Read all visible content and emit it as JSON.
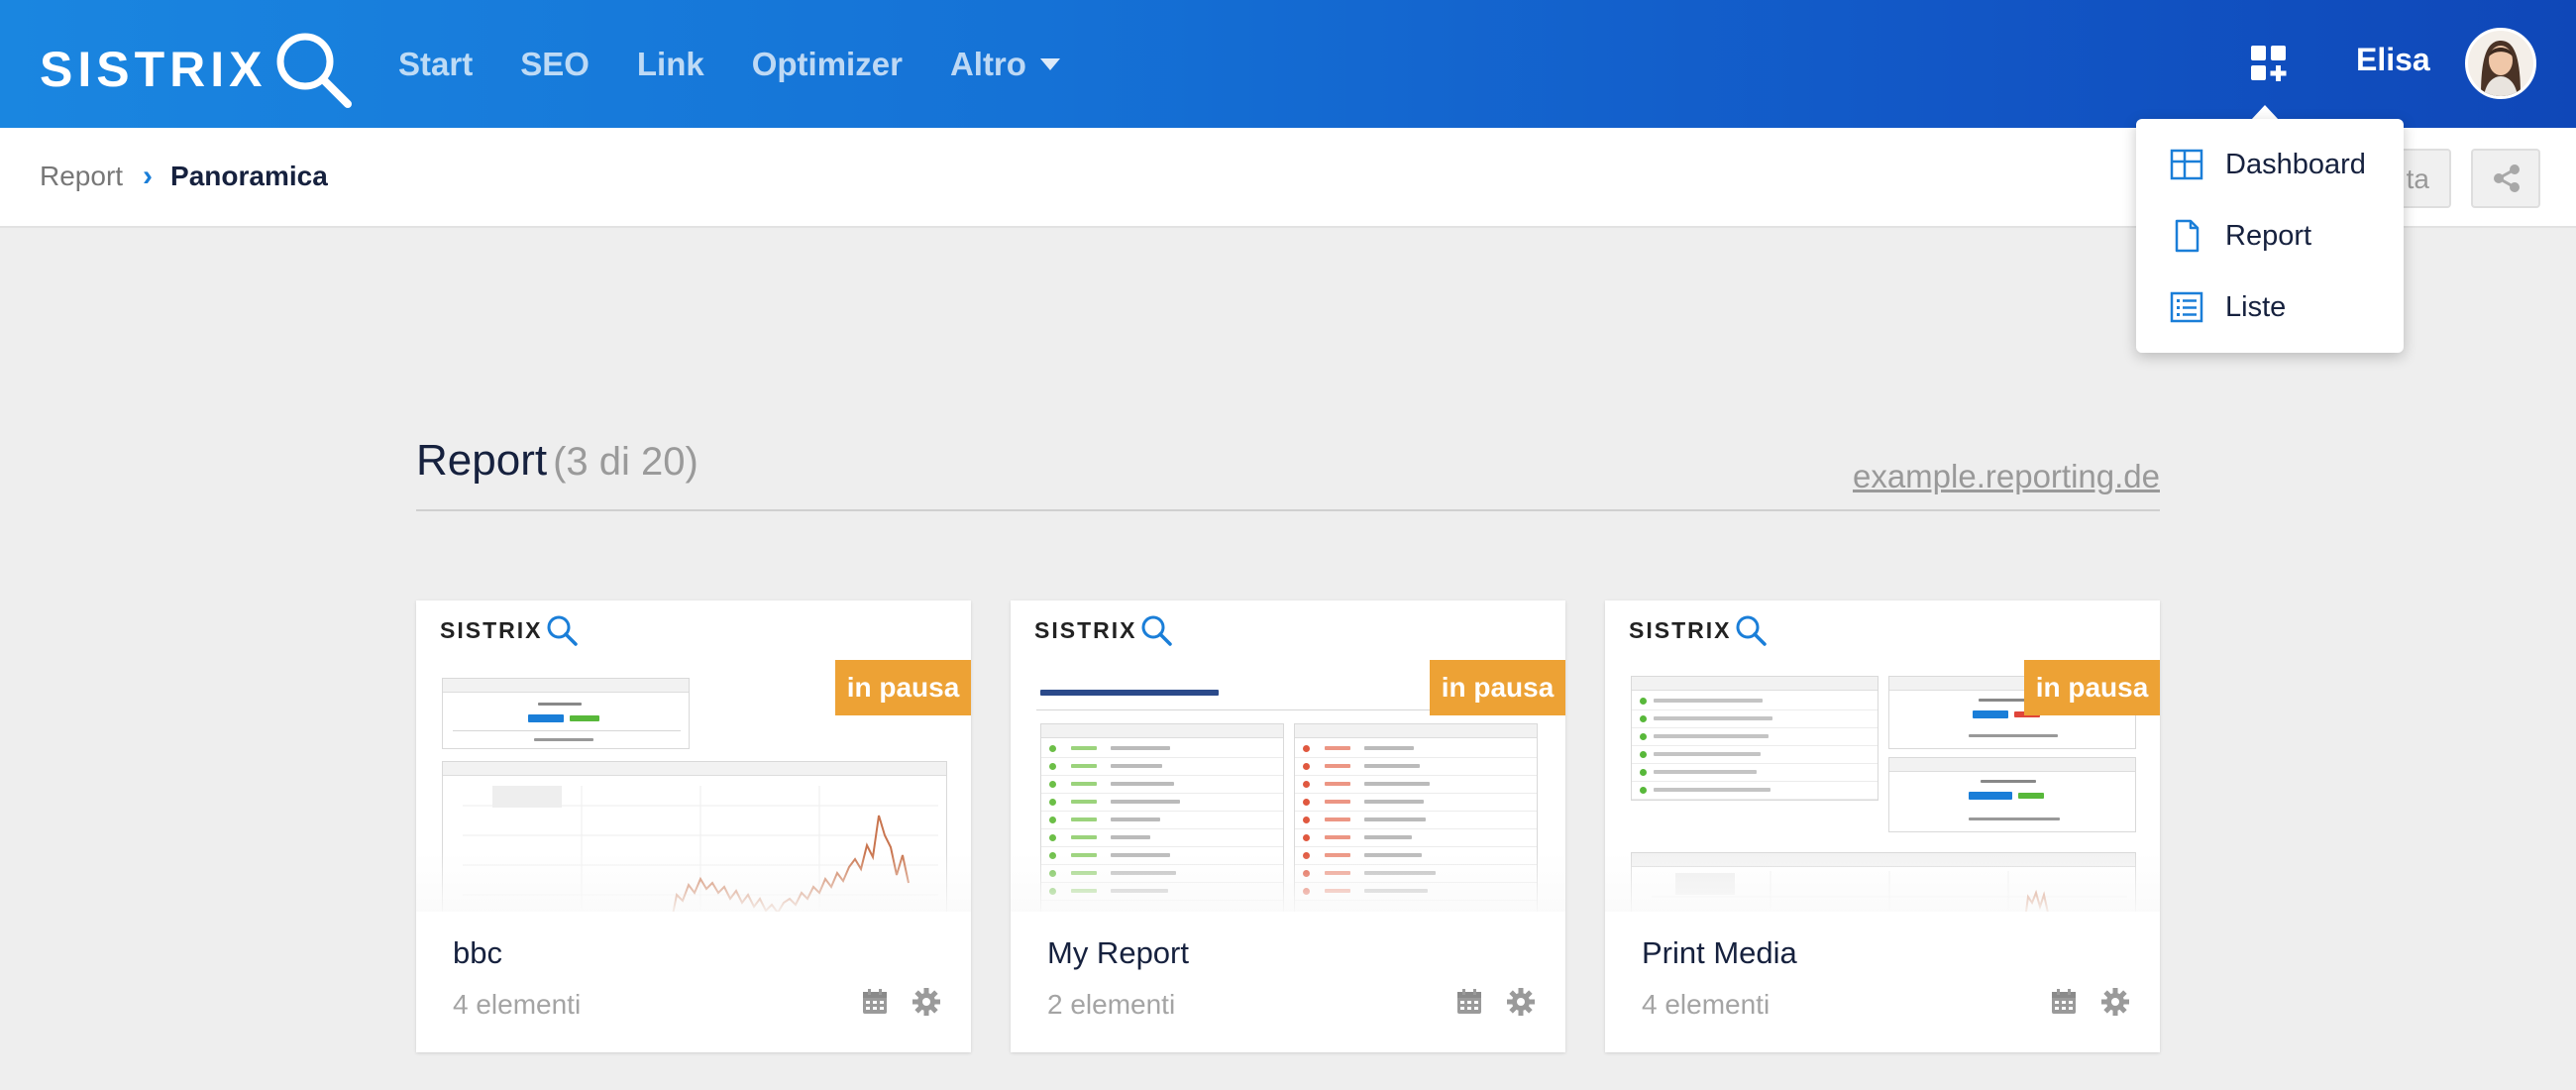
{
  "brand": {
    "logo_text": "SISTRIX",
    "accent": "#1a7ed8",
    "badge_color": "#eda235"
  },
  "nav": {
    "items": [
      {
        "label": "Start"
      },
      {
        "label": "SEO"
      },
      {
        "label": "Link"
      },
      {
        "label": "Optimizer"
      },
      {
        "label": "Altro"
      }
    ]
  },
  "user": {
    "name": "Elisa"
  },
  "breadcrumb": {
    "root": "Report",
    "current": "Panoramica"
  },
  "subbar": {
    "partial_button_text": "ta"
  },
  "dropdown": {
    "items": [
      {
        "label": "Dashboard",
        "icon": "dashboard-grid-icon"
      },
      {
        "label": "Report",
        "icon": "document-icon"
      },
      {
        "label": "Liste",
        "icon": "list-icon"
      }
    ]
  },
  "section": {
    "title": "Report",
    "count": "(3 di 20)",
    "link": "example.reporting.de"
  },
  "reports": [
    {
      "title": "bbc",
      "subtitle": "4 elementi",
      "status": "in pausa",
      "preview_logo": "SISTRIX"
    },
    {
      "title": "My Report",
      "subtitle": "2 elementi",
      "status": "in pausa",
      "preview_logo": "SISTRIX"
    },
    {
      "title": "Print Media",
      "subtitle": "4 elementi",
      "status": "in pausa",
      "preview_logo": "SISTRIX"
    }
  ]
}
